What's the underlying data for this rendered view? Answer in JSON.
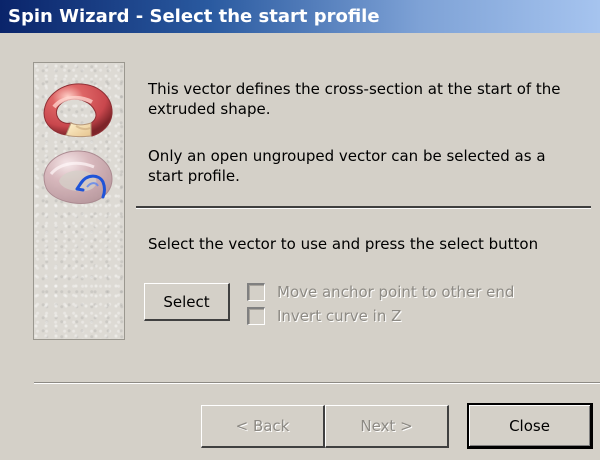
{
  "window": {
    "title": "Spin Wizard - Select the start profile"
  },
  "icons": {
    "top": "red-torus-icon",
    "bottom": "translucent-torus-with-profile-icon"
  },
  "main": {
    "description_1": "This vector defines the cross-section at the start of the extruded shape.",
    "description_2": "Only an open ungrouped vector can be selected as a start profile.",
    "instruction": "Select the vector to use and press the select button",
    "select_button": {
      "label": "Select",
      "enabled": true
    },
    "options": [
      {
        "label": "Move anchor point to other end",
        "checked": false,
        "enabled": false
      },
      {
        "label": "Invert curve in Z",
        "checked": false,
        "enabled": false
      }
    ]
  },
  "footer": {
    "back": {
      "label": "< Back",
      "enabled": false
    },
    "next": {
      "label": "Next >",
      "enabled": false
    },
    "close": {
      "label": "Close",
      "enabled": true,
      "default": true
    }
  },
  "colors": {
    "title_start": "#0a246a",
    "title_end": "#a6c4ef",
    "dialog_background": "#d4d0c8",
    "disabled_text": "#8d8a84",
    "torus_red": "#c9474d",
    "torus_highlight": "#f4dfb5",
    "profile_blue": "#1f54d8"
  }
}
